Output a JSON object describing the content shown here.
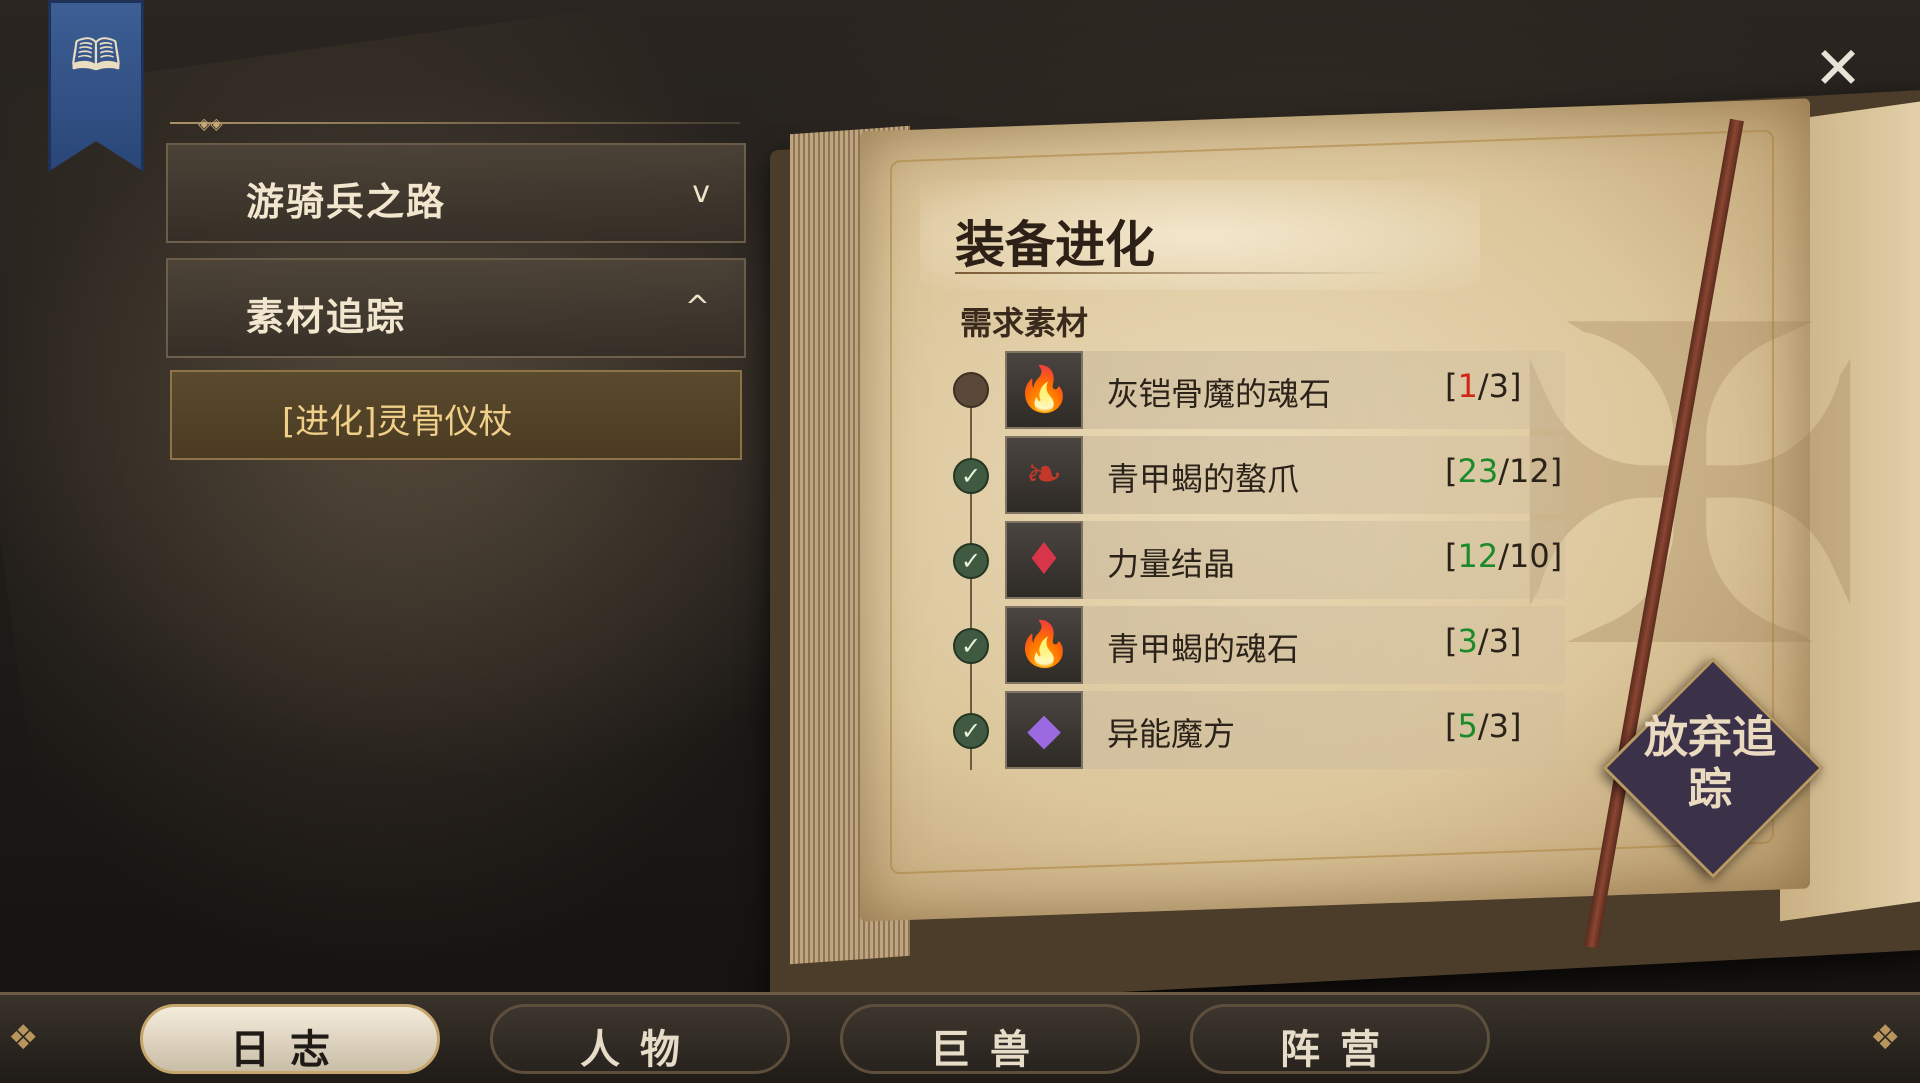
{
  "sidebar": {
    "items": [
      {
        "label": "游骑兵之路",
        "chevron": "v"
      },
      {
        "label": "素材追踪",
        "chevron": "^"
      }
    ],
    "sub_item": "[进化]灵骨仪杖"
  },
  "book": {
    "title": "装备进化",
    "section": "需求素材",
    "materials": [
      {
        "name": "灰铠骨魔的魂石",
        "have": "1",
        "need": "3",
        "complete": false,
        "icon": "soul-stone-flame-icon"
      },
      {
        "name": "青甲蝎的螯爪",
        "have": "23",
        "need": "12",
        "complete": true,
        "icon": "claw-icon"
      },
      {
        "name": "力量结晶",
        "have": "12",
        "need": "10",
        "complete": true,
        "icon": "red-crystal-icon"
      },
      {
        "name": "青甲蝎的魂石",
        "have": "3",
        "need": "3",
        "complete": true,
        "icon": "green-soul-flame-icon"
      },
      {
        "name": "异能魔方",
        "have": "5",
        "need": "3",
        "complete": true,
        "icon": "purple-gem-icon"
      }
    ],
    "abandon_label": "放弃追踪"
  },
  "tabs": [
    {
      "label": "日志",
      "active": true
    },
    {
      "label": "人物",
      "active": false
    },
    {
      "label": "巨兽",
      "active": false
    },
    {
      "label": "阵营",
      "active": false
    }
  ],
  "colors": {
    "count_insufficient": "#d0261a",
    "count_sufficient": "#1c8a2a",
    "banner": "#3d5f95"
  }
}
